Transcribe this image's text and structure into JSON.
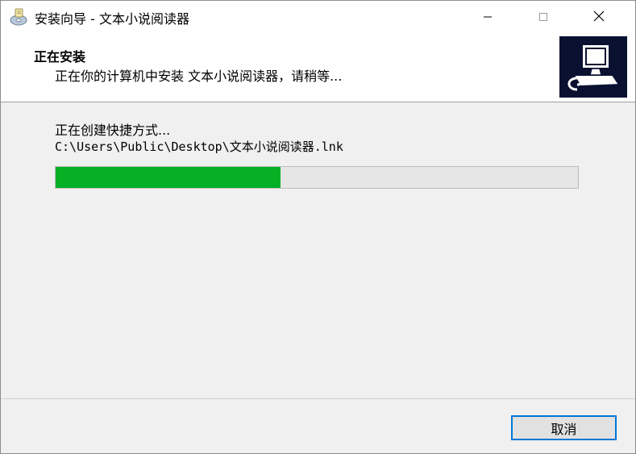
{
  "window": {
    "title": "安装向导 - 文本小说阅读器",
    "app_icon": "installer-disk-icon",
    "controls": {
      "minimize_icon": "minimize-icon",
      "maximize_icon": "maximize-icon",
      "close_icon": "close-icon"
    }
  },
  "header": {
    "title": "正在安装",
    "subtitle": "正在你的计算机中安装 文本小说阅读器，请稍等...",
    "logo_icon": "computer-installing-icon"
  },
  "body": {
    "status": "正在创建快捷方式...",
    "path": "C:\\Users\\Public\\Desktop\\文本小说阅读器.lnk",
    "progress": 0.43
  },
  "footer": {
    "cancel_label": "取消"
  },
  "colors": {
    "progress_fill": "#06b025",
    "focus_border": "#0078d7",
    "header_logo_bg": "#0a1030"
  }
}
